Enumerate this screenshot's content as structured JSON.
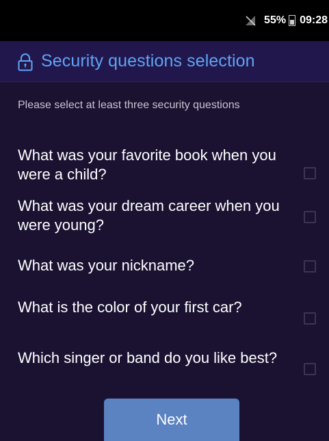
{
  "status": {
    "battery": "55%",
    "time": "09:28"
  },
  "header": {
    "title": "Security questions selection"
  },
  "instruction": "Please select at least three security questions",
  "questions": [
    {
      "label": "What was your favorite book when you were a child?",
      "checked": false
    },
    {
      "label": "What was your dream career when you were young?",
      "checked": false
    },
    {
      "label": "What was your nickname?",
      "checked": false
    },
    {
      "label": "What is the color of your first car?",
      "checked": false
    },
    {
      "label": "Which singer or band do you like best?",
      "checked": false
    }
  ],
  "actions": {
    "next_label": "Next"
  },
  "colors": {
    "title_blue": "#5ea4f5",
    "button_blue": "#5b82c1"
  }
}
